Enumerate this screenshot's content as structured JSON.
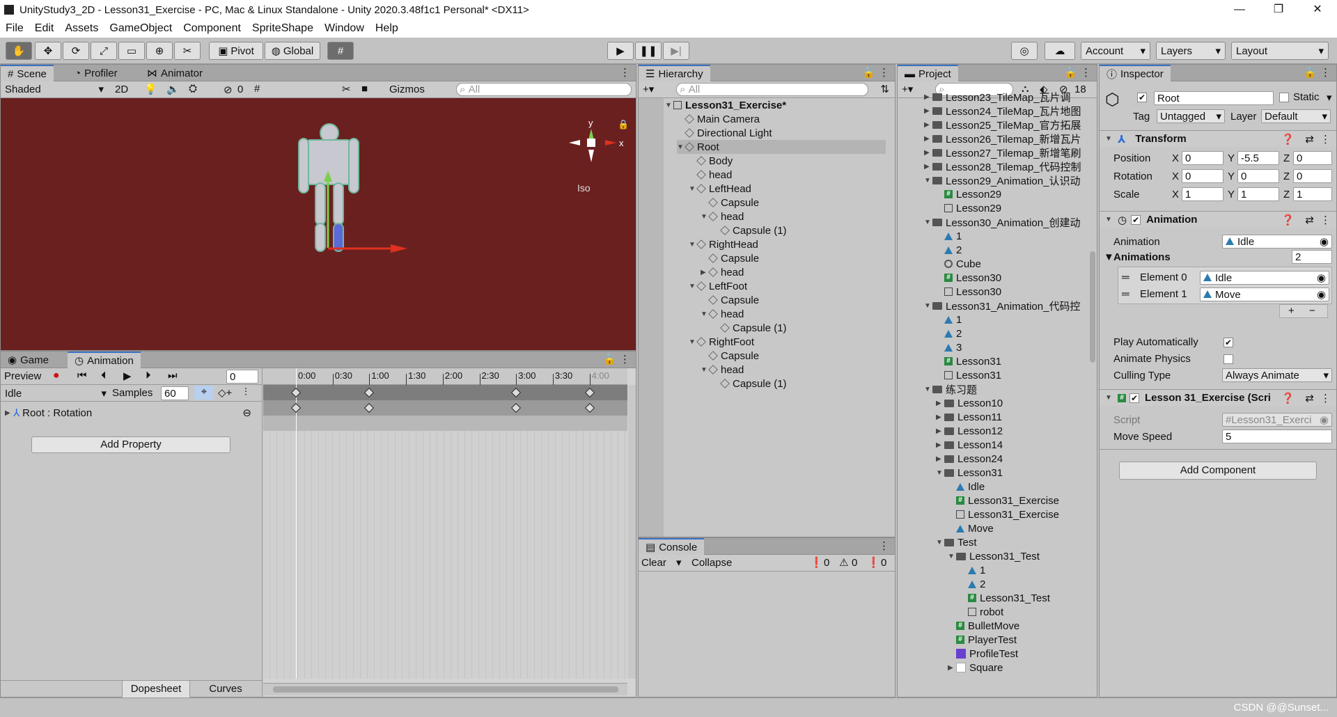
{
  "title": "UnityStudy3_2D - Lesson31_Exercise - PC, Mac & Linux Standalone - Unity 2020.3.48f1c1 Personal* <DX11>",
  "menu": [
    "File",
    "Edit",
    "Assets",
    "GameObject",
    "Component",
    "SpriteShape",
    "Window",
    "Help"
  ],
  "toolbar": {
    "pivot": "Pivot",
    "global": "Global",
    "account": "Account",
    "layers": "Layers",
    "layout": "Layout"
  },
  "scene": {
    "tabs": [
      "Scene",
      "Profiler",
      "Animator"
    ],
    "shading": "Shaded",
    "mode2d": "2D",
    "hidden_count": "0",
    "gizmos": "Gizmos",
    "search_placeholder": "All",
    "axis_y": "y",
    "axis_x": "x",
    "iso": "Iso",
    "bg_color": "#6b2020"
  },
  "animation": {
    "tabs": [
      "Game",
      "Animation"
    ],
    "preview": "Preview",
    "frame": "0",
    "clip": "Idle",
    "samples_label": "Samples",
    "samples": "60",
    "property": "Root : Rotation",
    "add_property": "Add Property",
    "time_labels": [
      "0:00",
      "0:30",
      "1:00",
      "1:30",
      "2:00",
      "2:30",
      "3:00",
      "3:30",
      "4:00"
    ],
    "bottom_tabs": [
      "Dopesheet",
      "Curves"
    ]
  },
  "hierarchy": {
    "tab": "Hierarchy",
    "search_placeholder": "All",
    "items": [
      {
        "label": "Lesson31_Exercise*",
        "depth": 0,
        "arrow": "▼",
        "icon": "scene"
      },
      {
        "label": "Main Camera",
        "depth": 1,
        "arrow": "",
        "icon": "go"
      },
      {
        "label": "Directional Light",
        "depth": 1,
        "arrow": "",
        "icon": "go"
      },
      {
        "label": "Root",
        "depth": 1,
        "arrow": "▼",
        "icon": "go"
      },
      {
        "label": "Body",
        "depth": 2,
        "arrow": "",
        "icon": "go"
      },
      {
        "label": "head",
        "depth": 2,
        "arrow": "",
        "icon": "go"
      },
      {
        "label": "LeftHead",
        "depth": 2,
        "arrow": "▼",
        "icon": "go"
      },
      {
        "label": "Capsule",
        "depth": 3,
        "arrow": "",
        "icon": "go"
      },
      {
        "label": "head",
        "depth": 3,
        "arrow": "▼",
        "icon": "go"
      },
      {
        "label": "Capsule (1)",
        "depth": 4,
        "arrow": "",
        "icon": "go"
      },
      {
        "label": "RightHead",
        "depth": 2,
        "arrow": "▼",
        "icon": "go"
      },
      {
        "label": "Capsule",
        "depth": 3,
        "arrow": "",
        "icon": "go"
      },
      {
        "label": "head",
        "depth": 3,
        "arrow": "▶",
        "icon": "go"
      },
      {
        "label": "LeftFoot",
        "depth": 2,
        "arrow": "▼",
        "icon": "go"
      },
      {
        "label": "Capsule",
        "depth": 3,
        "arrow": "",
        "icon": "go"
      },
      {
        "label": "head",
        "depth": 3,
        "arrow": "▼",
        "icon": "go"
      },
      {
        "label": "Capsule (1)",
        "depth": 4,
        "arrow": "",
        "icon": "go"
      },
      {
        "label": "RightFoot",
        "depth": 2,
        "arrow": "▼",
        "icon": "go"
      },
      {
        "label": "Capsule",
        "depth": 3,
        "arrow": "",
        "icon": "go"
      },
      {
        "label": "head",
        "depth": 3,
        "arrow": "▼",
        "icon": "go"
      },
      {
        "label": "Capsule (1)",
        "depth": 4,
        "arrow": "",
        "icon": "go"
      }
    ]
  },
  "console": {
    "tab": "Console",
    "clear": "Clear",
    "collapse": "Collapse",
    "counts": [
      "0",
      "0",
      "0"
    ]
  },
  "project": {
    "tab": "Project",
    "hidden_count": "18",
    "items": [
      {
        "label": "Lesson23_TileMap_瓦片调",
        "depth": 0,
        "arrow": "▶",
        "icon": "folder"
      },
      {
        "label": "Lesson24_TileMap_瓦片地图",
        "depth": 0,
        "arrow": "▶",
        "icon": "folder"
      },
      {
        "label": "Lesson25_TileMap_官方拓展",
        "depth": 0,
        "arrow": "▶",
        "icon": "folder"
      },
      {
        "label": "Lesson26_Tilemap_新增瓦片",
        "depth": 0,
        "arrow": "▶",
        "icon": "folder"
      },
      {
        "label": "Lesson27_Tilemap_新增笔刷",
        "depth": 0,
        "arrow": "▶",
        "icon": "folder"
      },
      {
        "label": "Lesson28_Tilemap_代码控制",
        "depth": 0,
        "arrow": "▶",
        "icon": "folder"
      },
      {
        "label": "Lesson29_Animation_认识动",
        "depth": 0,
        "arrow": "▼",
        "icon": "folder"
      },
      {
        "label": "Lesson29",
        "depth": 1,
        "arrow": "",
        "icon": "hash"
      },
      {
        "label": "Lesson29",
        "depth": 1,
        "arrow": "",
        "icon": "scene"
      },
      {
        "label": "Lesson30_Animation_创建动",
        "depth": 0,
        "arrow": "▼",
        "icon": "folder"
      },
      {
        "label": "1",
        "depth": 1,
        "arrow": "",
        "icon": "anim"
      },
      {
        "label": "2",
        "depth": 1,
        "arrow": "",
        "icon": "anim"
      },
      {
        "label": "Cube",
        "depth": 1,
        "arrow": "",
        "icon": "ctrl"
      },
      {
        "label": "Lesson30",
        "depth": 1,
        "arrow": "",
        "icon": "hash"
      },
      {
        "label": "Lesson30",
        "depth": 1,
        "arrow": "",
        "icon": "scene"
      },
      {
        "label": "Lesson31_Animation_代码控",
        "depth": 0,
        "arrow": "▼",
        "icon": "folder"
      },
      {
        "label": "1",
        "depth": 1,
        "arrow": "",
        "icon": "anim"
      },
      {
        "label": "2",
        "depth": 1,
        "arrow": "",
        "icon": "anim"
      },
      {
        "label": "3",
        "depth": 1,
        "arrow": "",
        "icon": "anim"
      },
      {
        "label": "Lesson31",
        "depth": 1,
        "arrow": "",
        "icon": "hash"
      },
      {
        "label": "Lesson31",
        "depth": 1,
        "arrow": "",
        "icon": "scene"
      },
      {
        "label": "练习题",
        "depth": 0,
        "arrow": "▼",
        "icon": "folder"
      },
      {
        "label": "Lesson10",
        "depth": 1,
        "arrow": "▶",
        "icon": "folder"
      },
      {
        "label": "Lesson11",
        "depth": 1,
        "arrow": "▶",
        "icon": "folder"
      },
      {
        "label": "Lesson12",
        "depth": 1,
        "arrow": "▶",
        "icon": "folder"
      },
      {
        "label": "Lesson14",
        "depth": 1,
        "arrow": "▶",
        "icon": "folder"
      },
      {
        "label": "Lesson24",
        "depth": 1,
        "arrow": "▶",
        "icon": "folder"
      },
      {
        "label": "Lesson31",
        "depth": 1,
        "arrow": "▼",
        "icon": "folder"
      },
      {
        "label": "Idle",
        "depth": 2,
        "arrow": "",
        "icon": "anim"
      },
      {
        "label": "Lesson31_Exercise",
        "depth": 2,
        "arrow": "",
        "icon": "hash"
      },
      {
        "label": "Lesson31_Exercise",
        "depth": 2,
        "arrow": "",
        "icon": "scene"
      },
      {
        "label": "Move",
        "depth": 2,
        "arrow": "",
        "icon": "anim"
      },
      {
        "label": "Test",
        "depth": 1,
        "arrow": "▼",
        "icon": "folder"
      },
      {
        "label": "Lesson31_Test",
        "depth": 2,
        "arrow": "▼",
        "icon": "folder"
      },
      {
        "label": "1",
        "depth": 3,
        "arrow": "",
        "icon": "anim"
      },
      {
        "label": "2",
        "depth": 3,
        "arrow": "",
        "icon": "anim"
      },
      {
        "label": "Lesson31_Test",
        "depth": 3,
        "arrow": "",
        "icon": "hash"
      },
      {
        "label": "robot",
        "depth": 3,
        "arrow": "",
        "icon": "scene"
      },
      {
        "label": "BulletMove",
        "depth": 2,
        "arrow": "",
        "icon": "hash"
      },
      {
        "label": "PlayerTest",
        "depth": 2,
        "arrow": "",
        "icon": "hash"
      },
      {
        "label": "ProfileTest",
        "depth": 2,
        "arrow": "",
        "icon": "prof"
      },
      {
        "label": "Square",
        "depth": 2,
        "arrow": "▶",
        "icon": "white"
      }
    ]
  },
  "inspector": {
    "tab": "Inspector",
    "name": "Root",
    "static": "Static",
    "tag_label": "Tag",
    "tag": "Untagged",
    "layer_label": "Layer",
    "layer": "Default",
    "transform": {
      "title": "Transform",
      "rows": [
        {
          "label": "Position",
          "x": "0",
          "y": "-5.5",
          "z": "0"
        },
        {
          "label": "Rotation",
          "x": "0",
          "y": "0",
          "z": "0"
        },
        {
          "label": "Scale",
          "x": "1",
          "y": "1",
          "z": "1"
        }
      ]
    },
    "animation": {
      "title": "Animation",
      "animation_label": "Animation",
      "animation_value": "Idle",
      "animations_label": "Animations",
      "animations_count": "2",
      "elements": [
        {
          "label": "Element 0",
          "value": "Idle"
        },
        {
          "label": "Element 1",
          "value": "Move"
        }
      ],
      "play_auto": "Play Automatically",
      "animate_physics": "Animate Physics",
      "culling_label": "Culling Type",
      "culling_value": "Always Animate"
    },
    "script": {
      "title": "Lesson 31_Exercise (Scri",
      "script_label": "Script",
      "script_value": "Lesson31_Exerci",
      "speed_label": "Move Speed",
      "speed_value": "5"
    },
    "add_component": "Add Component"
  },
  "watermark": "CSDN @@Sunset..."
}
